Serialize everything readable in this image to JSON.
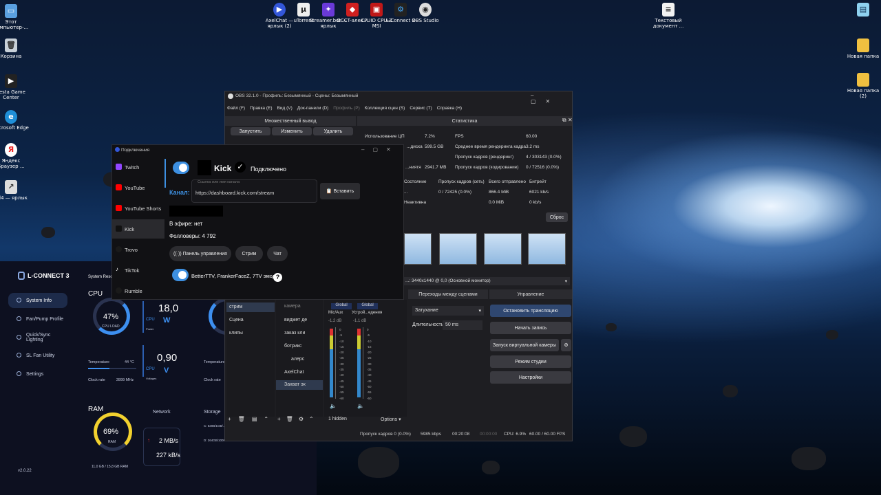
{
  "desktop": {
    "left_icons": [
      "Этот компьютер-...",
      "Корзина",
      "Lesta Game Center",
      "Microsoft Edge",
      "Яндекс Браузер ...",
      "rel4 — ярлык"
    ],
    "top_icons": [
      "AxelChat — ярлык (2)",
      "uTorrent",
      "Streamer.bot — ярлык",
      "OCCT-алек...",
      "CPUID CPU-Z MSI",
      "L-Connect 3",
      "OBS Studio"
    ],
    "right_icons": [
      "Текстовый документ ...",
      "Новая папка",
      "Новая папка (2)"
    ]
  },
  "lconnect": {
    "title": "L-CONNECT 3",
    "nav": [
      "System Info",
      "Fan/Pump Profile",
      "Quick/Sync Lighting",
      "SL Fan Utility",
      "Settings"
    ],
    "version": "v2.0.22",
    "section": "System Reso...",
    "cpu_label": "CPU",
    "cpu_load_value": "47%",
    "cpu_load_label": "CPU LOAD",
    "cpu_power_value": "18,0",
    "cpu_power_unit": "W",
    "cpu_power_label": "Power",
    "cpu_volt_value": "0,90",
    "cpu_volt_unit": "V",
    "cpu_volt_label": "Voltages",
    "temp_label": "Temperature",
    "temp_value": "44 °C",
    "clock_label": "Clock rate",
    "clock_value": "2899 MHz",
    "temp_label2": "Temperature",
    "clock_label2": "Clock rate",
    "ram_label": "RAM",
    "ram_value": "69%",
    "ram_sub": "RAM",
    "ram_usage": "11,0 GB / 15,8 GB RAM",
    "network_label": "Network",
    "net_up": "2 MB/s",
    "net_down": "227 kB/s",
    "storage_label": "Storage",
    "storage_c": "C: 620B/1GB/...",
    "storage_d": "D: 264GB/1008GB/..."
  },
  "obs": {
    "title": "OBS 32.1.0 - Профиль: Безымянный - Сцены: Безымянный",
    "menu": [
      "Файл (F)",
      "Правка (E)",
      "Вид (V)",
      "Док-панели (D)",
      "Профиль (P)",
      "Коллекция сцен (S)",
      "Сервис (T)",
      "Справка (H)"
    ],
    "multi_title": "Множественный вывод",
    "multi_buttons": [
      "Запустить",
      "Изменить",
      "Удалить"
    ],
    "stats_title": "Статистика",
    "stats_left": [
      [
        "Использование ЦП",
        "7.2%"
      ],
      [
        "...диска",
        "599.5 GB"
      ],
      [
        "...ниятя",
        "2941.7 MB"
      ]
    ],
    "stats_right": [
      [
        "FPS",
        "60.00"
      ],
      [
        "Среднее время рендеринга кадра",
        "3.2 ms"
      ],
      [
        "Пропуск кадров (рендеринг)",
        "4 / 303143 (0.0%)"
      ],
      [
        "Пропуск кадров (кодирование)",
        "0 / 72516 (0.0%)"
      ]
    ],
    "stats_header": [
      "Состояние",
      "Пропуск кадров (сеть)",
      "Всего отправлено",
      "Битрейт"
    ],
    "stats_rows": [
      [
        "...",
        "0 / 72425 (0.0%)",
        "866.4 MiB",
        "6021 kb/s"
      ],
      [
        "Неактивна",
        "",
        "0.0 MiB",
        "0 kb/s"
      ]
    ],
    "reset": "Сброс",
    "monitor": "...: 3440x1440 @ 0,0 (Основной монитор)",
    "scenes": [
      "стрим",
      "Сцена",
      "клипы"
    ],
    "sources": [
      "камера",
      "виджет де",
      "заказ кли",
      "ботрикс",
      "алерс",
      "AxelChat",
      "Захват эк"
    ],
    "mixer": {
      "ch1": "Global",
      "ch2": "Global",
      "name1": "Mic/Aux",
      "name2": "Устрой...едения",
      "db1": "-1.2 dB",
      "db2": "-1.1 dB",
      "scale": [
        "0",
        "-5",
        "-10",
        "-15",
        "-20",
        "-25",
        "-30",
        "-35",
        "-40",
        "-45",
        "-50",
        "-55",
        "-60"
      ]
    },
    "transitions_title": "Переходы между сценами",
    "transition": "Затухание",
    "duration_label": "Длительность",
    "duration": "50 ms",
    "controls_title": "Управление",
    "controls": [
      "Остановить трансляцию",
      "Начать запись",
      "Запуск виртуальной камеры",
      "Режим студии",
      "Настройки"
    ],
    "hidden": "1 hidden",
    "options": "Options",
    "status": {
      "dropped": "Пропуск кадров 0 (0.0%)",
      "bitrate": "5985 kbps",
      "stream_time": "00:20:08",
      "rec_time": "00:00:00",
      "cpu": "CPU: 6.9%",
      "fps": "60.00 / 60.00 FPS"
    }
  },
  "conn": {
    "title": "Подключения",
    "services": [
      "Twitch",
      "YouTube",
      "YouTube Shorts",
      "Kick",
      "Trovo",
      "TikTok",
      "Rumble"
    ],
    "service_colors": [
      "#9146ff",
      "#ff0000",
      "#ff0000",
      "#111111",
      "#1a1a1a",
      "#111111",
      "#111111"
    ],
    "platform": "Kick",
    "status": "Подключено",
    "channel_label": "Канал:",
    "channel_hint": "Ссылка или имя канала",
    "channel_value": "https://dashboard.kick.com/stream",
    "paste": "Вставить",
    "live": "В эфире: нет",
    "followers": "Фолловеры: 4 792",
    "buttons": [
      "Панель управления",
      "Стрим",
      "Чат"
    ],
    "emotes": "BetterTTV, FrankerFaceZ, 7TV эмодзи",
    "accent": "#3d8fe0"
  }
}
